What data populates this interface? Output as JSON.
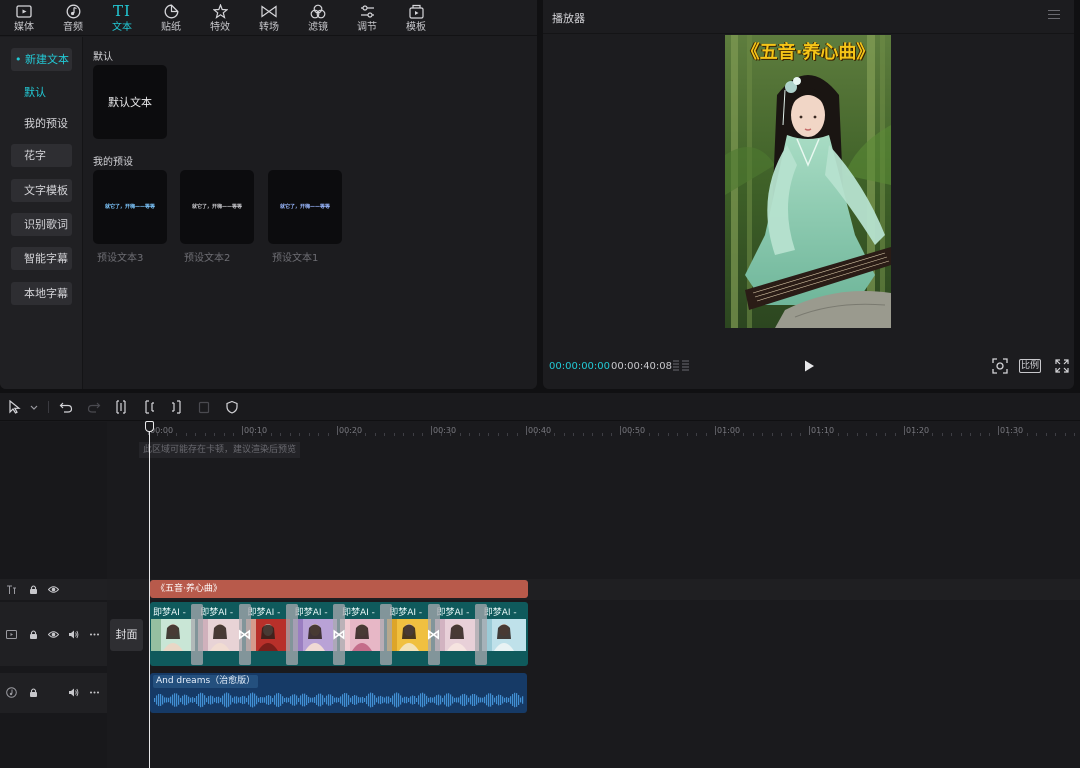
{
  "top_tabs": [
    {
      "label": "媒体",
      "icon": "media-icon"
    },
    {
      "label": "音频",
      "icon": "audio-icon"
    },
    {
      "label": "文本",
      "icon": "text-icon",
      "active": true
    },
    {
      "label": "贴纸",
      "icon": "sticker-icon"
    },
    {
      "label": "特效",
      "icon": "effects-icon"
    },
    {
      "label": "转场",
      "icon": "transition-icon"
    },
    {
      "label": "滤镜",
      "icon": "filter-icon"
    },
    {
      "label": "调节",
      "icon": "adjust-icon"
    },
    {
      "label": "模板",
      "icon": "template-icon"
    }
  ],
  "text_tab_glyph": "TI",
  "side_nav": {
    "new_text": "• 新建文本",
    "default": "默认",
    "my_presets": "我的预设",
    "fancy_text": "花字",
    "text_template": "文字模板",
    "recognize_lyrics": "识别歌词",
    "smart_subtitles": "智能字幕",
    "local_subtitles": "本地字幕"
  },
  "content": {
    "default_section": "默认",
    "default_card_text": "默认文本",
    "presets_section": "我的预设",
    "preset_preview_text": "就它了，开嗨——等等",
    "presets": [
      {
        "label": "预设文本3",
        "color": "#7ec8ff"
      },
      {
        "label": "预设文本2",
        "color": "#c8c8cc"
      },
      {
        "label": "预设文本1",
        "color": "#9ab8ff"
      }
    ]
  },
  "player": {
    "title": "播放器",
    "video_title": "《五音·养心曲》",
    "current_time": "00:00:00:00",
    "total_time": "00:00:40:08",
    "ratio_label": "比例"
  },
  "timeline": {
    "ruler_ticks": [
      "00:00",
      "00:10",
      "00:20",
      "00:30",
      "00:40",
      "00:50",
      "01:00",
      "01:10",
      "01:20",
      "01:30"
    ],
    "ruler_note": "此区域可能存在卡顿，建议渲染后预览",
    "text_clip": "《五音·养心曲》",
    "cover_label": "封面",
    "video_clip_label": "即梦AI - ",
    "video_clip_count": 8,
    "audio_clip": "And dreams（治愈版）"
  },
  "colors": {
    "accent": "#22c9d5",
    "text_clip": "#b85a4b",
    "video_clip": "#0f5a5c",
    "audio_clip": "#163a66"
  }
}
